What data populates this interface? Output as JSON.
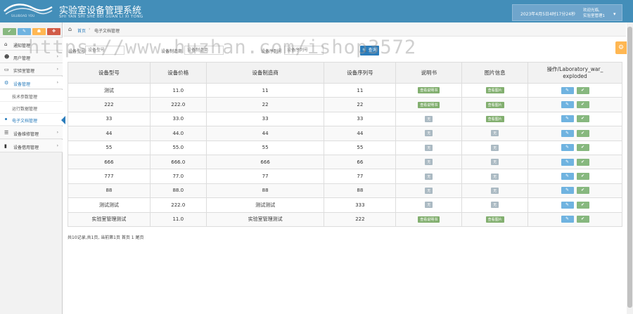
{
  "header": {
    "logo_text": "SILUBOAD YOU",
    "title": "实验室设备管理系统",
    "subtitle": "SHI YAN SHI SHE BEI GUAN LI XI TONG",
    "datetime": "2023年4月5日4时17分24秒",
    "welcome_line1": "欢迎光临,",
    "welcome_line2": "实验室管理1",
    "caret": "▾"
  },
  "sidebar": {
    "shortcuts": [
      {
        "icon": "signal-icon",
        "glyph": "✔",
        "color": "#87b87f"
      },
      {
        "icon": "pencil-icon",
        "glyph": "✎",
        "color": "#6fb3e0"
      },
      {
        "icon": "users-icon",
        "glyph": "☗",
        "color": "#ffb752"
      },
      {
        "icon": "cogs-icon",
        "glyph": "✥",
        "color": "#d15b47"
      }
    ],
    "items": [
      {
        "label": "通知管理",
        "icon": "home-icon",
        "glyph": "⌂"
      },
      {
        "label": "用户管理",
        "icon": "users-icon",
        "glyph": "☻",
        "chevron": "›"
      },
      {
        "label": "实验室管理",
        "icon": "desktop-icon",
        "glyph": "▭",
        "chevron": "›"
      },
      {
        "label": "设备管理",
        "icon": "cogs-icon",
        "glyph": "⚙",
        "chevron": "›"
      },
      {
        "label": "设备维修管理",
        "icon": "list-icon",
        "glyph": "☰",
        "chevron": "›"
      },
      {
        "label": "设备借用管理",
        "icon": "bookmark-icon",
        "glyph": "▮",
        "chevron": "›"
      }
    ],
    "subitems": [
      {
        "label": "技术参数管理"
      },
      {
        "label": "运行数据管理"
      },
      {
        "label": "电子文档管理"
      }
    ]
  },
  "breadcrumb": {
    "home": "首页",
    "sep": "›",
    "current": "电子文档管理"
  },
  "filter": {
    "label1": "设备型号",
    "placeholder1": "设备型号",
    "label2": "设备制造商",
    "placeholder2": "设备制造商",
    "label3": "设备序列号",
    "placeholder3": "设备序列号",
    "search_label": "查询",
    "search_glyph": "🔍"
  },
  "watermark": "https://www.huzhan.com/ishop3572",
  "table": {
    "headers": [
      "设备型号",
      "设备价格",
      "设备制造商",
      "设备序列号",
      "说明书",
      "图片信息",
      "操作/Laboratory_war_exploded"
    ],
    "rows": [
      {
        "model": "测试",
        "price": "11.0",
        "maker": "11",
        "serial": "11",
        "manual": "查看说明书",
        "manual_has": true,
        "image": "查看图片",
        "image_has": true
      },
      {
        "model": "222",
        "price": "222.0",
        "maker": "22",
        "serial": "22",
        "manual": "查看说明书",
        "manual_has": true,
        "image": "查看图片",
        "image_has": true
      },
      {
        "model": "33",
        "price": "33.0",
        "maker": "33",
        "serial": "33",
        "manual": "无",
        "manual_has": false,
        "image": "查看图片",
        "image_has": true
      },
      {
        "model": "44",
        "price": "44.0",
        "maker": "44",
        "serial": "44",
        "manual": "无",
        "manual_has": false,
        "image": "无",
        "image_has": false
      },
      {
        "model": "55",
        "price": "55.0",
        "maker": "55",
        "serial": "55",
        "manual": "无",
        "manual_has": false,
        "image": "无",
        "image_has": false
      },
      {
        "model": "666",
        "price": "666.0",
        "maker": "666",
        "serial": "66",
        "manual": "无",
        "manual_has": false,
        "image": "无",
        "image_has": false
      },
      {
        "model": "777",
        "price": "77.0",
        "maker": "77",
        "serial": "77",
        "manual": "无",
        "manual_has": false,
        "image": "无",
        "image_has": false
      },
      {
        "model": "88",
        "price": "88.0",
        "maker": "88",
        "serial": "88",
        "manual": "无",
        "manual_has": false,
        "image": "无",
        "image_has": false
      },
      {
        "model": "测试测试",
        "price": "222.0",
        "maker": "测试测试",
        "serial": "333",
        "manual": "无",
        "manual_has": false,
        "image": "无",
        "image_has": false
      },
      {
        "model": "实验室管理测试",
        "price": "11.0",
        "maker": "实验室管理测试",
        "serial": "222",
        "manual": "查看说明书",
        "manual_has": true,
        "image": "查看图片",
        "image_has": true
      }
    ],
    "edit_glyph": "✎",
    "ok_glyph": "✔"
  },
  "footer": "共10记录,共1页, 当前第1页 首页 1 尾页",
  "settings_glyph": "⚙",
  "colors": {
    "header_bg": "#438eb9",
    "accent": "#2b7dbc",
    "badge_green": "#82af6f",
    "badge_gray": "#abbac3",
    "btn_edit": "#6fb3e0",
    "btn_ok": "#87b87f",
    "settings": "#ffb752"
  }
}
